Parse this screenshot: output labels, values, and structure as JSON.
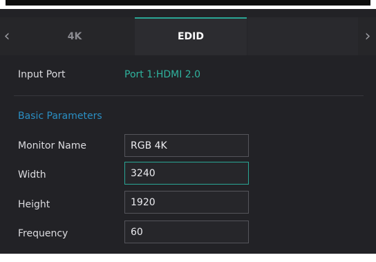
{
  "nav": {
    "left_arrow": "‹",
    "right_arrow": "›"
  },
  "tabs": [
    {
      "label": "4K",
      "active": false
    },
    {
      "label": "EDID",
      "active": true
    },
    {
      "label": "",
      "active": false
    }
  ],
  "input_port": {
    "label": "Input Port",
    "value": "Port 1:HDMI 2.0"
  },
  "basic_parameters": {
    "title": "Basic Parameters",
    "fields": [
      {
        "label": "Monitor Name",
        "value": "RGB 4K",
        "focused": false
      },
      {
        "label": "Width",
        "value": "3240",
        "focused": true
      },
      {
        "label": "Height",
        "value": "1920",
        "focused": false
      },
      {
        "label": "Frequency",
        "value": "60",
        "focused": false
      }
    ]
  },
  "colors": {
    "panel_bg": "#222226",
    "accent_teal": "#2aa796",
    "port_value": "#2fb39e",
    "section_blue": "#2a8fc4"
  }
}
